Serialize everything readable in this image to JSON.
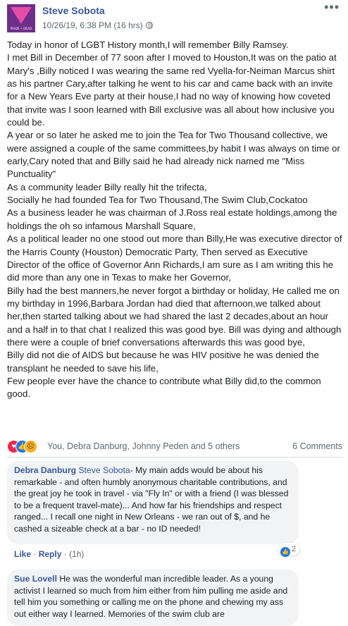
{
  "post": {
    "author": "Steve Sobota",
    "timestamp": "10/26/19, 6:38 PM (16 hrs)",
    "avatar_caption": "PRIDE • DEAD",
    "text": "Today in honor of LGBT History month,I will remember Billy Ramsey.\nI met Bill in December of 77 soon after I moved to Houston,It was on the patio at Mary's ,Billy noticed I was wearing the same red Vyella-for-Neiman Marcus shirt as his partner Cary,after talking he went to his car and came back with an invite for a New Years Eve party at their house,I had no way of knowing how coveted that invite was I soon learned with Bill exclusive was all about how inclusive you could be.\nA year or so later he asked me to join the Tea for Two Thousand collective, we were assigned a couple of the same committees,by habit I was always on time or early,Cary noted that and Billy said he had already nick named me \"Miss Punctuality\"\nAs a community leader Billy really hit the trifecta,\nSocially he had founded Tea for Two Thousand,The Swim Club,Cockatoo\nAs a business leader he was chairman of J.Ross real estate holdings,among the holdings the oh so infamous Marshall Square,\nAs a political leader no one stood out more than Billy,He was executive director of the Harris County (Houston) Democratic Party, Then served as Executive Director of the office of Governor Ann Richards,I am sure as I am writing this he did more than any one in Texas to make her Governor,\nBilly had the best manners,he never forgot a birthday or holiday, He called me on my birthday in 1996,Barbara Jordan had died that afternoon,we talked about her,then started talking about we had shared the last 2 decades,about an hour and a half in to that chat I realized this was good bye. Bill was dying and although there were a couple of brief conversations afterwards this was good bye,\nBilly did not die of AIDS but because he was HIV positive he was denied the transplant he needed to save his life,\nFew people ever have the chance to contribute what Billy did,to the common good.",
    "reactions_names": "You, Debra Danburg, Johnny Peden and 5 others",
    "comments_count": "6 Comments"
  },
  "comments": [
    {
      "author": "Debra Danburg",
      "mention": "Steve Sobota",
      "text": "- My main adds would be about his remarkable - and often humbly anonymous charitable contributions, and the great joy he took in travel - via \"Fly In\" or with a friend (I was blessed to be a frequent travel-mate)... And how far his friendships and respect ranged... I recall one night in New Orleans - we ran out of $, and he cashed a sizeable check at a bar - no ID needed!",
      "like_label": "Like",
      "reply_label": "Reply",
      "age": "(1h)",
      "likes": "2"
    },
    {
      "author": "Sue Lovell",
      "text": "He was the wonderful man incredible leader. As a young activist I learned so much from him either from him pulling me aside and tell him you something or calling me on the phone and chewing my ass out either way I learned. Memories of the swim club are"
    }
  ],
  "icons": [
    "more-icon",
    "globe-icon",
    "love-reaction-icon",
    "like-reaction-icon",
    "sad-reaction-icon",
    "like-badge-icon"
  ],
  "colors": {
    "link": "#385898",
    "muted": "#606770",
    "comment_bg": "#f2f3f5",
    "like_blue": "#1877f2",
    "love_red": "#f0284a"
  }
}
